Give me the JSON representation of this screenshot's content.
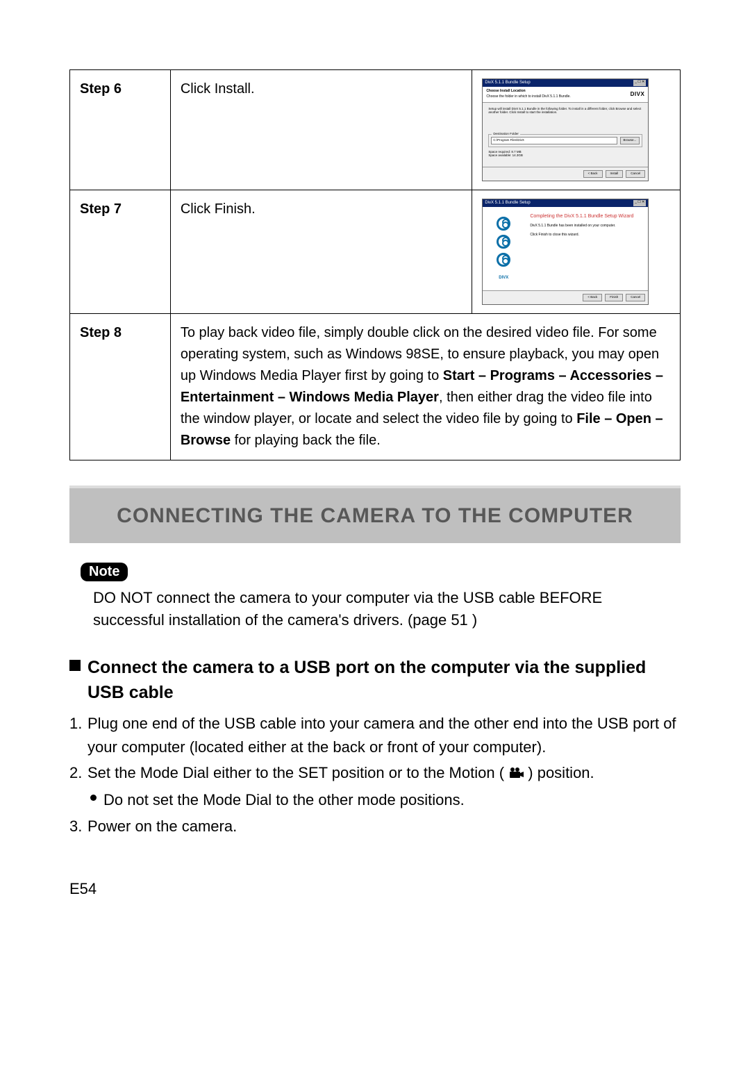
{
  "steps": {
    "step6": {
      "label": "Step 6",
      "content": "Click Install."
    },
    "step7": {
      "label": "Step 7",
      "content": "Click Finish."
    },
    "step8": {
      "label": "Step 8",
      "part1": "To play back video file, simply double click on the desired video file. For some operating system, such as Windows 98SE, to ensure playback, you may open up Windows Media Player first by going to ",
      "bold1": "Start – Programs – Accessories – Entertainment – Windows Media Player",
      "part2": ", then either drag the video file into the window player, or locate and select the video file by going to ",
      "bold2": "File – Open – Browse",
      "part3": " for playing back the file."
    }
  },
  "installer6": {
    "title": "DivX 5.1.1 Bundle Setup",
    "header_bold": "Choose Install Location",
    "header_sub": "Choose the folder in which to install DivX 5.1.1 Bundle.",
    "logo": "DIVX",
    "desc": "Setup will install DivX 5.1.1 Bundle in the following folder. To install in a different folder, click Browse and select another folder. Click Install to start the installation.",
    "legend": "Destination Folder",
    "path": "C:\\Program Files\\DivX",
    "browse": "Browse...",
    "space1": "Space required: 8.7 MB",
    "space2": "Space available: 14.3GB",
    "btn_back": "< Back",
    "btn_install": "Install",
    "btn_cancel": "Cancel"
  },
  "installer7": {
    "title": "DivX 5.1.1 Bundle Setup",
    "ftitle": "Completing the DivX 5.1.1 Bundle Setup Wizard",
    "fdesc1": "DivX 5.1.1 Bundle has been installed on your computer.",
    "fdesc2": "Click Finish to close this wizard.",
    "btn_back": "< Back",
    "btn_finish": "Finish",
    "btn_cancel": "Cancel"
  },
  "section_heading": "CONNECTING THE CAMERA TO THE COMPUTER",
  "note": {
    "badge": "Note",
    "text": "DO NOT connect the camera to your computer via the USB cable BEFORE successful installation of the camera's drivers. (page 51 )"
  },
  "subheading": "Connect the camera to a USB port on the computer via the supplied USB cable",
  "list": {
    "i1": {
      "num": "1.",
      "text": "Plug one end of the USB cable into your camera and the other end into the USB port  of  your computer (located either at the back or front of your computer)."
    },
    "i2": {
      "num": "2.",
      "text_a": "Set the Mode Dial either to the SET position or to the Motion ( ",
      "text_b": " ) position."
    },
    "i2_sub": "Do not set the Mode Dial to the other mode positions.",
    "i3": {
      "num": "3.",
      "text": "Power on the camera."
    }
  },
  "page_num": "E54"
}
